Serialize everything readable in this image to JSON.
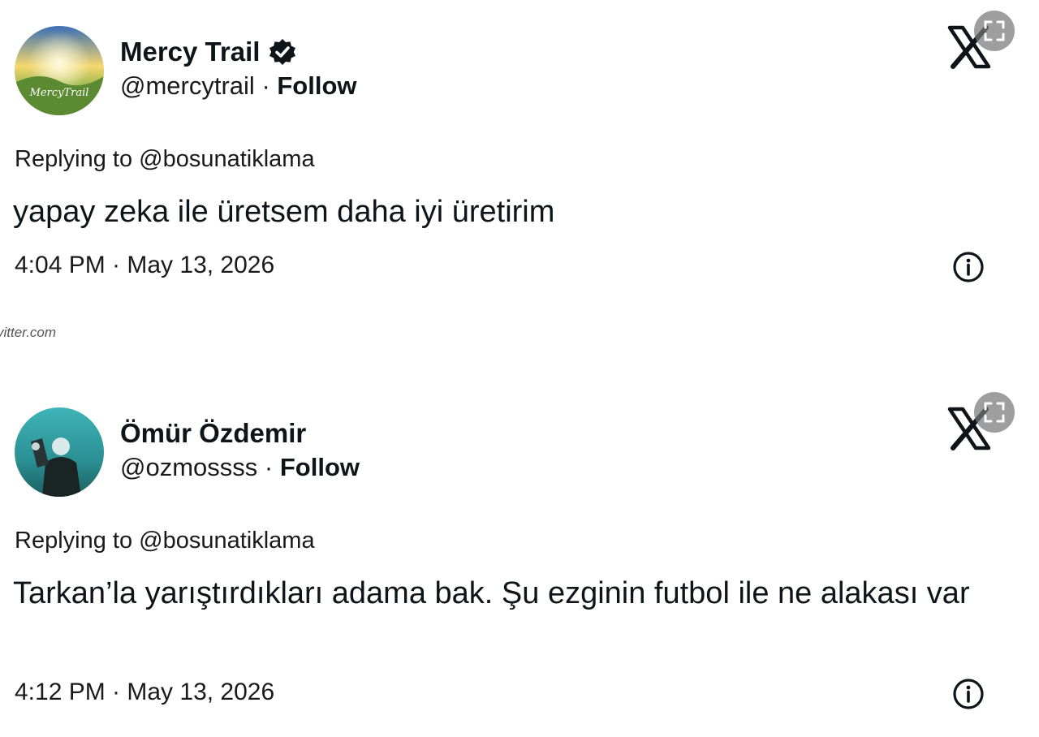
{
  "source_label": "vitter.com",
  "tweets": [
    {
      "display_name": "Mercy Trail",
      "verified": true,
      "handle": "@mercytrail",
      "separator": "·",
      "follow_label": "Follow",
      "replying_to": "Replying to @bosunatiklama",
      "text": "yapay zeka ile üretsem daha iyi üretirim",
      "timestamp": "4:04 PM · May 13, 2026",
      "avatar_label": "MercyTrail"
    },
    {
      "display_name": "Ömür Özdemir",
      "verified": false,
      "handle": "@ozmossss",
      "separator": "·",
      "follow_label": "Follow",
      "replying_to": "Replying to @bosunatiklama",
      "text": "Tarkan’la yarıştırdıkları adama bak. Şu ezginin futbol ile ne alakası var",
      "timestamp": "4:12 PM · May 13, 2026"
    }
  ],
  "icons": {
    "verified": "verified-badge-icon",
    "x_logo": "x-logo-icon",
    "expand": "expand-icon",
    "info": "info-icon"
  },
  "colors": {
    "text": "#0f1419",
    "secondary": "#1a1a1a",
    "verified_fill": "#0f1419"
  }
}
